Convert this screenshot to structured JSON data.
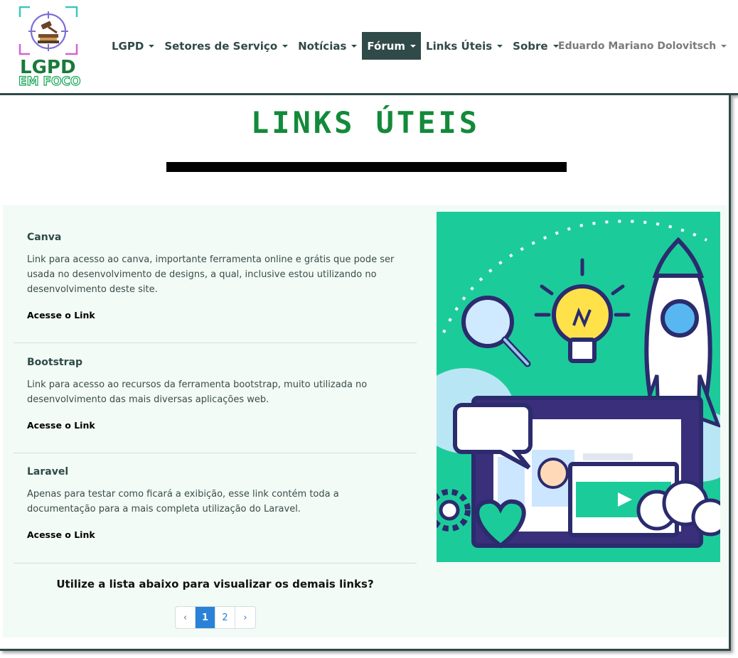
{
  "brand": {
    "logo_line1": "LGPD",
    "logo_line2": "EM FOCO"
  },
  "nav": {
    "items": [
      {
        "label": "LGPD"
      },
      {
        "label": "Setores de Serviço"
      },
      {
        "label": "Notícias"
      },
      {
        "label": "Fórum"
      },
      {
        "label": "Links Úteis"
      },
      {
        "label": "Sobre"
      }
    ],
    "active": "Fórum",
    "user": "Eduardo Mariano Dolovitsch"
  },
  "page": {
    "title": "LINKS ÚTEIS",
    "links": [
      {
        "title": "Canva",
        "description": "Link para acesso ao canva, importante ferramenta online e grátis que pode ser usada no desenvolvimento de designs, a qual, inclusive estou utilizando no desenvolvimento deste site.",
        "cta": "Acesse o Link"
      },
      {
        "title": "Bootstrap",
        "description": "Link para acesso ao recursos da ferramenta bootstrap, muito utilizada no desenvolvimento das mais diversas aplicações web.",
        "cta": "Acesse o Link"
      },
      {
        "title": "Laravel",
        "description": "Apenas para testar como ficará a exibição, esse link contém toda a documentação para a mais completa utilização do Laravel.",
        "cta": "Acesse o Link"
      }
    ],
    "bottom_text": "Utilize a lista abaixo para visualizar os demais links?",
    "pagination": {
      "prev": "‹",
      "pages": [
        "1",
        "2"
      ],
      "current": "1",
      "next": "›"
    }
  },
  "colors": {
    "nav_dark": "#2f4a48",
    "title_green": "#138a3a",
    "panel_bg": "#f2fbf6",
    "illustration_bg": "#1ccb9a",
    "page_active": "#2a82d8"
  },
  "icons": {
    "illustration": "creative-tech-illustration-icon"
  }
}
